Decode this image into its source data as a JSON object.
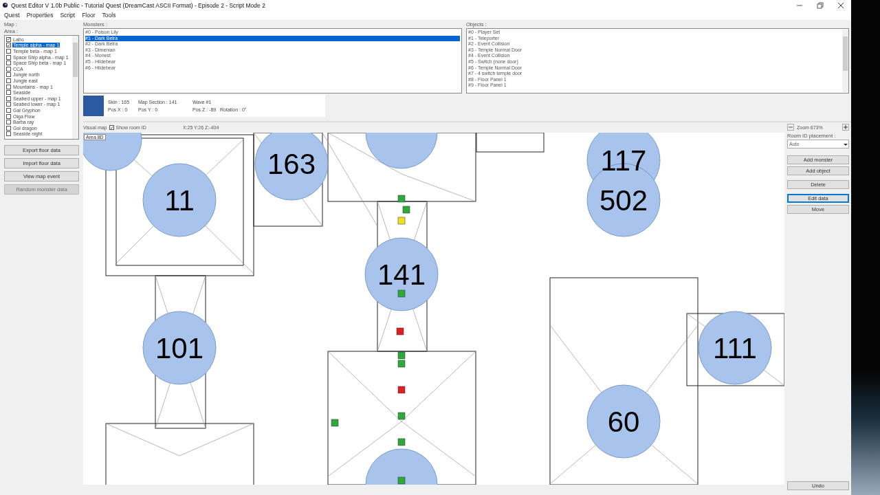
{
  "window": {
    "title": "Quest Editor V 1.0b Public - Tutorial Quest (DreamCast ASCII Format) - Episode 2 - Script Mode 2"
  },
  "menu": [
    "Quest",
    "Properties",
    "Script",
    "Floor",
    "Tools"
  ],
  "sidebar": {
    "map_label": "Map :",
    "area_label": "Area :",
    "areas": [
      {
        "label": "Labo",
        "checked": true,
        "selected": false
      },
      {
        "label": "Temple alpha - map 1",
        "checked": true,
        "selected": true
      },
      {
        "label": "Temple beta - map 1",
        "checked": false,
        "selected": false
      },
      {
        "label": "Space Ship alpha - map 1",
        "checked": false,
        "selected": false
      },
      {
        "label": "Space Ship beta - map 1",
        "checked": false,
        "selected": false
      },
      {
        "label": "CCA",
        "checked": false,
        "selected": false
      },
      {
        "label": "Jungle north",
        "checked": false,
        "selected": false
      },
      {
        "label": "Jungle east",
        "checked": false,
        "selected": false
      },
      {
        "label": "Mountains - map 1",
        "checked": false,
        "selected": false
      },
      {
        "label": "Seaside",
        "checked": false,
        "selected": false
      },
      {
        "label": "Seabed upper - map 1",
        "checked": false,
        "selected": false
      },
      {
        "label": "Seabed lower - map 1",
        "checked": false,
        "selected": false
      },
      {
        "label": "Gal Gryphon",
        "checked": false,
        "selected": false
      },
      {
        "label": "Olga Flow",
        "checked": false,
        "selected": false
      },
      {
        "label": "Barba ray",
        "checked": false,
        "selected": false
      },
      {
        "label": "Gol dragon",
        "checked": false,
        "selected": false
      },
      {
        "label": "Seaside night",
        "checked": false,
        "selected": false
      }
    ],
    "buttons": [
      {
        "label": "Export floor data",
        "disabled": false
      },
      {
        "label": "Import floor data",
        "disabled": false
      },
      {
        "label": "View map event",
        "disabled": false
      },
      {
        "label": "Random monster data",
        "disabled": true
      }
    ]
  },
  "monsters": {
    "label": "Monsters :",
    "items": [
      {
        "label": "#0 - Poison Lily",
        "selected": false
      },
      {
        "label": "#1 - Dark Belra",
        "selected": true
      },
      {
        "label": "#2 - Dark Belra",
        "selected": false
      },
      {
        "label": "#3 - Dimenian",
        "selected": false
      },
      {
        "label": "#4 - Monest",
        "selected": false
      },
      {
        "label": "#5 - Hildebear",
        "selected": false
      },
      {
        "label": "#6 - Hildebear",
        "selected": false
      }
    ]
  },
  "objects": {
    "label": "Objects :",
    "items": [
      "#0 - Player Set",
      "#1 - Teleporter",
      "#2 - Event Collision",
      "#3 - Temple Normal Door",
      "#4 - Event Collision",
      "#5 - Switch (none door)",
      "#6 - Temple Normal Door",
      "#7 - 4 switch temple door",
      "#8 - Floor Panel 1",
      "#9 - Floor Panel 1"
    ]
  },
  "details": {
    "row_1": [
      "Skin : 165",
      "Map Section : 141",
      "Wave #1"
    ],
    "row_2": [
      "Pos X : 0",
      "Pos Y : 0",
      "Pos Z : -89",
      "Rotation : 0°"
    ]
  },
  "map_toolbar": {
    "label": "Visual map",
    "show_room_id": {
      "label": "Show room ID",
      "checked": true
    },
    "coordinates": "X:25 Y:26 Z:-404"
  },
  "map": {
    "area_tag": "Area 8D",
    "rooms": [
      "163",
      "11",
      "117",
      "502",
      "141",
      "101",
      "111",
      "60"
    ]
  },
  "right_panel": {
    "zoom": "Zoom 673%",
    "placement_label": "Room ID placement :",
    "placement_value": "Auto",
    "buttons": [
      {
        "label": "Add monster",
        "focused": false
      },
      {
        "label": "Add object",
        "focused": false
      },
      {
        "label": "Delete",
        "focused": false
      },
      {
        "label": "Edit data",
        "focused": true
      },
      {
        "label": "Move",
        "focused": false
      }
    ],
    "undo": "Undo"
  }
}
